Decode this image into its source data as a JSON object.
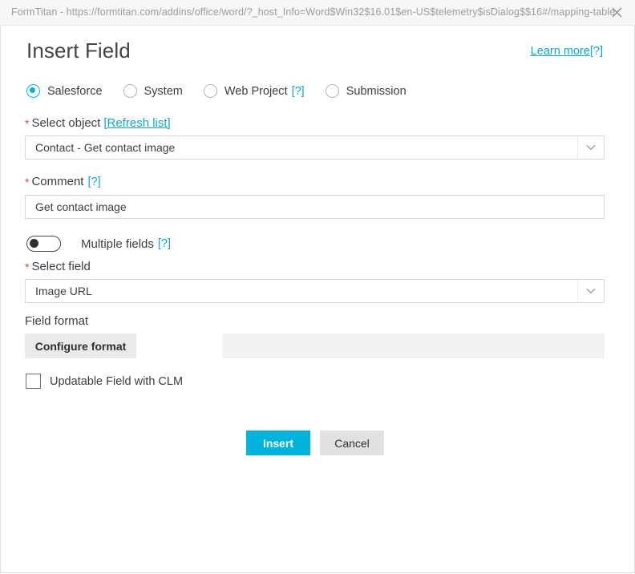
{
  "window": {
    "title": "FormTitan - https://formtitan.com/addins/office/word/?_host_Info=Word$Win32$16.01$en-US$telemetry$isDialog$$16#/mapping-table",
    "close_icon": "close-icon"
  },
  "header": {
    "title": "Insert Field",
    "learn_more": "Learn more",
    "learn_more_hint": "[?]"
  },
  "source_type": {
    "options": [
      {
        "label": "Salesforce",
        "selected": true,
        "hint": ""
      },
      {
        "label": "System",
        "selected": false,
        "hint": ""
      },
      {
        "label": "Web Project",
        "selected": false,
        "hint": "[?]"
      },
      {
        "label": "Submission",
        "selected": false,
        "hint": ""
      }
    ]
  },
  "select_object": {
    "required_marker": "*",
    "label": "Select object",
    "refresh_link": "[Refresh list]",
    "value": "Contact - Get contact image",
    "arrow_icon": "chevron-down-icon"
  },
  "comment": {
    "required_marker": "*",
    "label": "Comment",
    "hint": "[?]",
    "value": "Get contact image"
  },
  "multiple_fields": {
    "label": "Multiple fields",
    "hint": "[?]",
    "state": "off"
  },
  "select_field": {
    "required_marker": "*",
    "label": "Select field",
    "value": "Image URL",
    "arrow_icon": "chevron-down-icon"
  },
  "field_format": {
    "label": "Field format",
    "configure_button": "Configure format",
    "preview_value": ""
  },
  "updatable_field": {
    "label": "Updatable Field with CLM",
    "checked": false
  },
  "footer": {
    "insert_label": "Insert",
    "cancel_label": "Cancel"
  },
  "colors": {
    "accent": "#00b4dd",
    "link": "#0aa8d2",
    "required": "#e8413a",
    "button_gray": "#e1e1e1",
    "panel_gray": "#f2f2f2"
  }
}
